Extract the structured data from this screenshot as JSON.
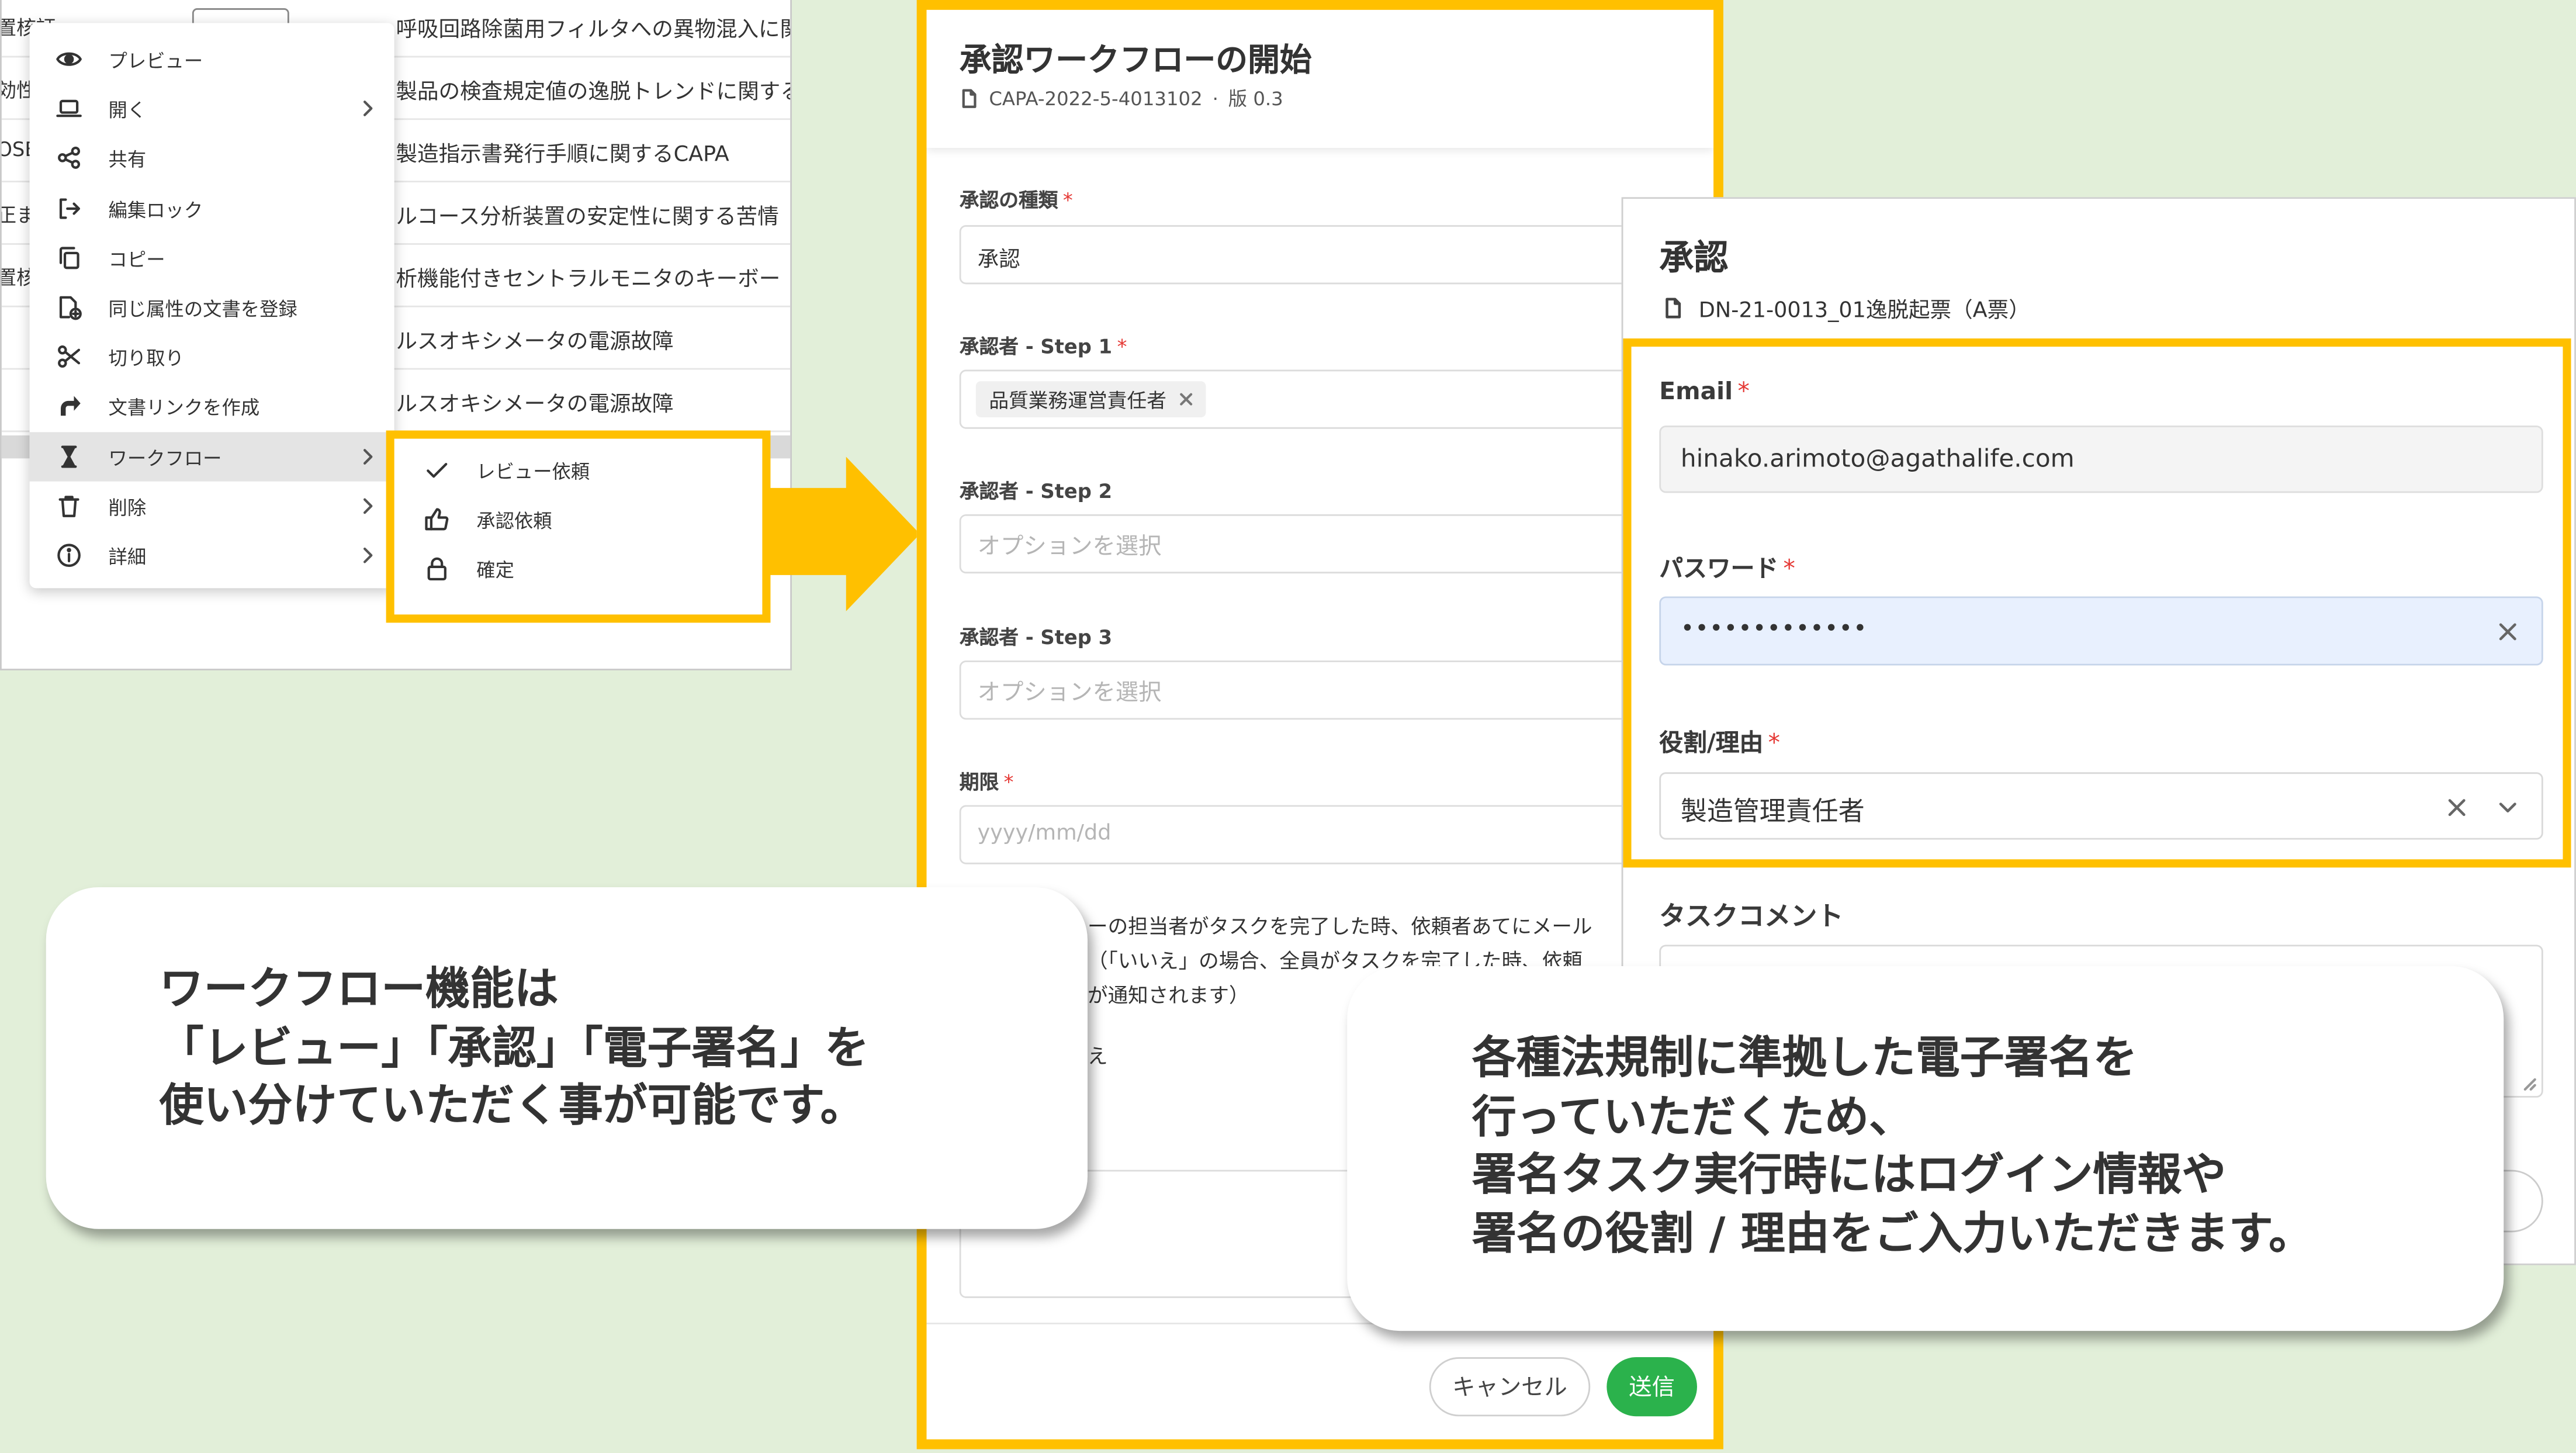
{
  "page": {
    "background": "#e2efd9",
    "accent": "#ffc000",
    "submit_color": "#2bb24c",
    "required_color": "#e53935"
  },
  "common": {
    "required_mark": "*"
  },
  "doc_list": {
    "row_prefixes": [
      "置核証",
      "効性",
      "OSE",
      "正ま",
      "置核"
    ],
    "row_titles": [
      "呼吸回路除菌用フィルタへの異物混入に関",
      "製品の検査規定値の逸脱トレンドに関する",
      "製造指示書発行手順に関するCAPA",
      "ルコース分析装置の安定性に関する苦情",
      "析機能付きセントラルモニタのキーボー",
      "ルスオキシメータの電源故障",
      "ルスオキシメータの電源故障"
    ]
  },
  "context_menu": {
    "items": [
      {
        "label": "プレビュー",
        "icon": "eye-icon",
        "has_submenu": false
      },
      {
        "label": "開く",
        "icon": "laptop-icon",
        "has_submenu": true
      },
      {
        "label": "共有",
        "icon": "share-icon",
        "has_submenu": false
      },
      {
        "label": "編集ロック",
        "icon": "arrow-right-from-bracket-icon",
        "has_submenu": false
      },
      {
        "label": "コピー",
        "icon": "copy-icon",
        "has_submenu": false
      },
      {
        "label": "同じ属性の文書を登録",
        "icon": "file-plus-icon",
        "has_submenu": false
      },
      {
        "label": "切り取り",
        "icon": "scissors-icon",
        "has_submenu": false
      },
      {
        "label": "文書リンクを作成",
        "icon": "share-arrow-icon",
        "has_submenu": false
      },
      {
        "label": "ワークフロー",
        "icon": "hourglass-icon",
        "has_submenu": true,
        "active": true
      },
      {
        "label": "削除",
        "icon": "trash-icon",
        "has_submenu": true
      },
      {
        "label": "詳細",
        "icon": "info-icon",
        "has_submenu": true
      }
    ]
  },
  "submenu": {
    "items": [
      {
        "label": "レビュー依頼",
        "icon": "check-icon"
      },
      {
        "label": "承認依頼",
        "icon": "thumbs-up-icon"
      },
      {
        "label": "確定",
        "icon": "lock-icon"
      }
    ]
  },
  "workflow_dialog": {
    "title": "承認ワークフローの開始",
    "doc_id": "CAPA-2022-5-4013102",
    "separator": "·",
    "version": "版 0.3",
    "approval_type": {
      "label": "承認の種類",
      "value": "承認"
    },
    "step1": {
      "label": "承認者 - Step 1",
      "tag": "品質業務運営責任者"
    },
    "step2": {
      "label": "承認者 - Step 2",
      "placeholder": "オプションを選択"
    },
    "step3": {
      "label": "承認者 - Step 3",
      "placeholder": "オプションを選択"
    },
    "due": {
      "label": "期限",
      "placeholder": "yyyy/mm/dd"
    },
    "notify_lines": [
      "ーの担当者がタスクを完了した時、依頼者あてにメール",
      "（「いいえ」の場合、全員がタスクを完了した時、依頼",
      "が通知されます）"
    ],
    "radio_partial": "え",
    "cancel_label": "キャンセル",
    "submit_label": "送信"
  },
  "sign_dialog": {
    "title": "承認",
    "doc_name": "DN-21-0013_01逸脱起票（A票）",
    "email": {
      "label": "Email",
      "value": "hinako.arimoto@agathalife.com"
    },
    "password": {
      "label": "パスワード",
      "value": "•••••••••••••"
    },
    "role": {
      "label": "役割/理由",
      "value": "製造管理責任者"
    },
    "comment": {
      "label": "タスクコメント"
    }
  },
  "callouts": {
    "left": [
      "ワークフロー機能は",
      "「レビュー」「承認」「電子署名」を",
      "使い分けていただく事が可能です。"
    ],
    "right": [
      "各種法規制に準拠した電子署名を",
      "行っていただくため、",
      "署名タスク実行時にはログイン情報や",
      "署名の役割 / 理由をご入力いただきます。"
    ]
  }
}
